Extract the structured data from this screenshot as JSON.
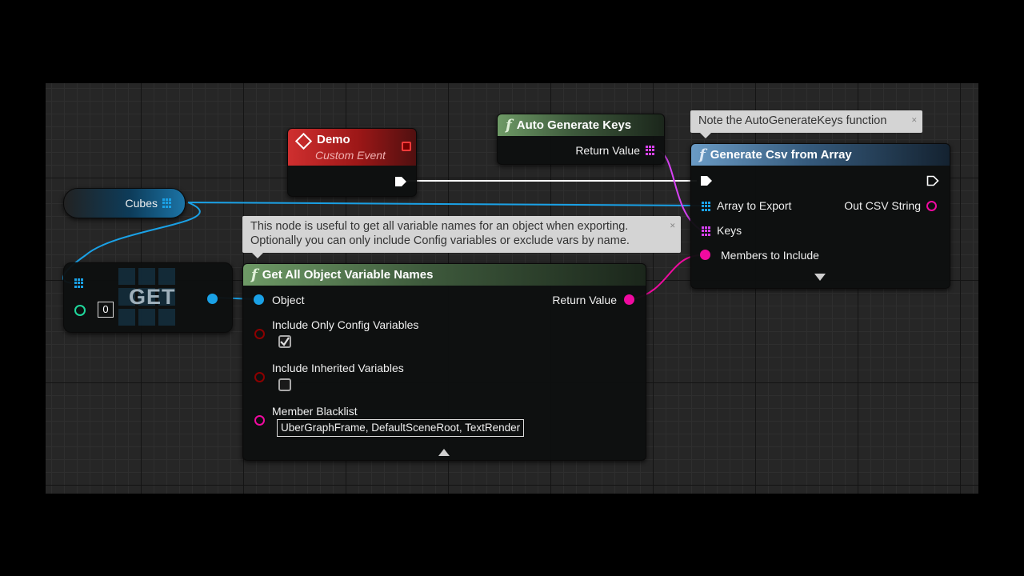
{
  "colors": {
    "exec": "#ffffff",
    "object": "#1aa1e6",
    "array": "#1aa1e6",
    "string_array": "#d742f4",
    "name_array": "#f00aa0",
    "bool": "#8c0000",
    "int": "#1fd89c",
    "string": "#f00aa0"
  },
  "comments": {
    "auto_keys_note": "Note the AutoGenerateKeys function",
    "variable_names_note_line1": "This node is useful to get all variable names for an object when exporting.",
    "variable_names_note_line2": "Optionally you can only include Config variables or exclude vars by name."
  },
  "demo_event": {
    "title": "Demo",
    "subtitle": "Custom Event",
    "icon": "event-diamond-icon"
  },
  "auto_keys_node": {
    "title": "Auto Generate Keys",
    "return_label": "Return Value",
    "icon": "function-icon"
  },
  "csv_node": {
    "title": "Generate Csv from Array",
    "array_label": "Array to Export",
    "keys_label": "Keys",
    "members_label": "Members to Include",
    "out_label": "Out CSV String",
    "icon": "function-icon"
  },
  "cubes_var": {
    "label": "Cubes"
  },
  "get_node": {
    "title": "GET",
    "index_value": "0"
  },
  "var_names_node": {
    "title": "Get All Object Variable Names",
    "object_label": "Object",
    "return_label": "Return Value",
    "config_label": "Include Only Config Variables",
    "config_checked": true,
    "inherited_label": "Include Inherited Variables",
    "inherited_checked": false,
    "blacklist_label": "Member Blacklist",
    "blacklist_value": "UberGraphFrame, DefaultSceneRoot, TextRender"
  }
}
